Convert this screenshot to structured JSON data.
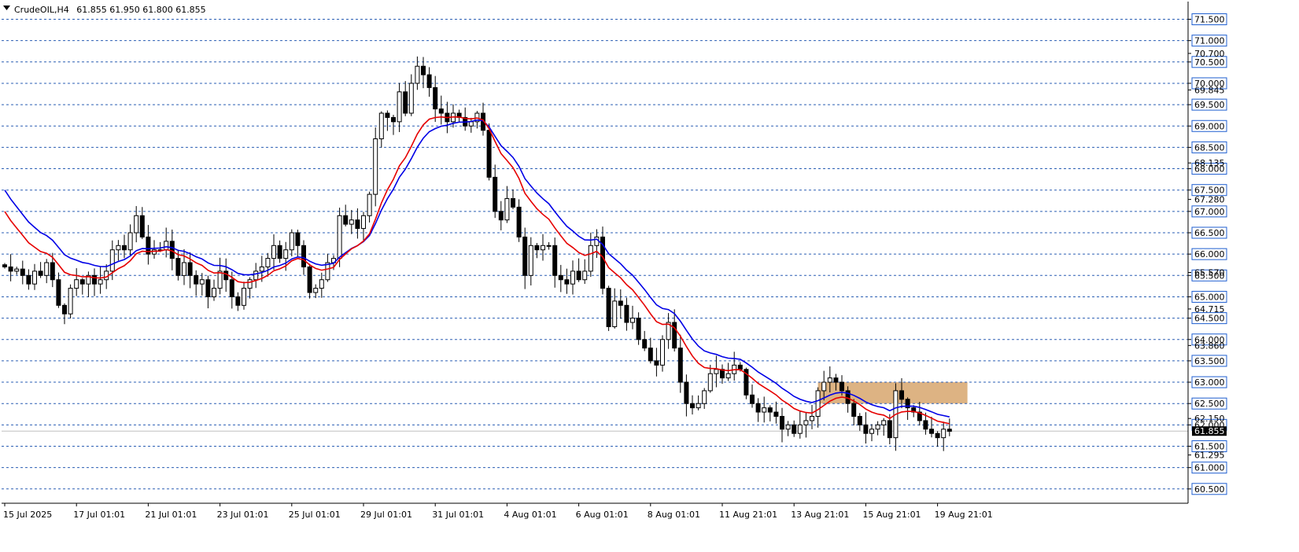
{
  "header": {
    "symbol": "CrudeOIL,H4",
    "ohlc": "61.855 61.950 61.800 61.855"
  },
  "colors": {
    "grid": "#2b5fb4",
    "ma_fast": "#e60000",
    "ma_slow": "#0000e6",
    "zone": "#ddb383",
    "tag_fill": "#1f5fd0",
    "current_tag": "#000000"
  },
  "chart_data": {
    "type": "candlestick",
    "timeframe": "H4",
    "ylim": [
      60.3,
      71.75
    ],
    "y_ticks_major": [
      71.5,
      71.0,
      70.5,
      70.0,
      69.5,
      69.0,
      68.5,
      68.0,
      67.5,
      67.0,
      66.5,
      66.0,
      65.5,
      65.0,
      64.5,
      64.0,
      63.5,
      63.0,
      62.5,
      62.0,
      61.5,
      61.0,
      60.5
    ],
    "y_ticks_labels": [
      "71.500",
      "71.000",
      "70.500",
      "70.000",
      "69.500",
      "69.000",
      "68.500",
      "68.000",
      "67.500",
      "67.000",
      "66.500",
      "66.000",
      "65.500",
      "65.000",
      "64.500",
      "64.000",
      "63.500",
      "63.000",
      "62.500",
      "62.000",
      "61.500",
      "61.000",
      "60.500"
    ],
    "y_ticks_minor": [
      {
        "value": 70.7,
        "label": "70.700"
      },
      {
        "value": 69.845,
        "label": "69.845"
      },
      {
        "value": 68.135,
        "label": "68.135"
      },
      {
        "value": 67.28,
        "label": "67.280"
      },
      {
        "value": 65.57,
        "label": "65.570"
      },
      {
        "value": 64.715,
        "label": "64.715"
      },
      {
        "value": 63.86,
        "label": "63.860"
      },
      {
        "value": 62.15,
        "label": "62.150"
      },
      {
        "value": 61.295,
        "label": "61.295"
      }
    ],
    "current_price": 61.855,
    "current_price_label": "61.855",
    "x_ticks": [
      "15 Jul 2025",
      "17 Jul 01:01",
      "21 Jul 01:01",
      "23 Jul 01:01",
      "25 Jul 01:01",
      "29 Jul 01:01",
      "31 Jul 01:01",
      "4 Aug 01:01",
      "6 Aug 01:01",
      "8 Aug 01:01",
      "11 Aug 21:01",
      "13 Aug 21:01",
      "15 Aug 21:01",
      "19 Aug 21:01"
    ],
    "x_tick_index": [
      0,
      12,
      24,
      36,
      48,
      60,
      72,
      84,
      96,
      108,
      120,
      132,
      144,
      156
    ],
    "zone": {
      "from_index": 136,
      "to_index": 161,
      "y_low": 62.5,
      "y_high": 63.0
    },
    "closes": [
      65.7,
      65.6,
      65.65,
      65.5,
      65.3,
      65.6,
      65.5,
      65.8,
      65.4,
      64.8,
      64.6,
      65.2,
      65.4,
      65.3,
      65.5,
      65.3,
      65.4,
      65.6,
      66.1,
      66.2,
      66.1,
      66.5,
      66.9,
      66.4,
      66.0,
      66.1,
      66.1,
      66.3,
      65.9,
      65.5,
      65.8,
      65.5,
      65.3,
      65.4,
      65.0,
      65.2,
      65.6,
      65.4,
      65.0,
      64.8,
      65.2,
      65.4,
      65.6,
      65.7,
      65.9,
      66.2,
      65.9,
      66.1,
      66.5,
      66.2,
      65.7,
      65.1,
      65.2,
      65.4,
      65.8,
      65.9,
      66.9,
      66.7,
      66.8,
      66.6,
      66.9,
      67.4,
      68.7,
      69.3,
      69.2,
      69.1,
      69.8,
      69.3,
      70.0,
      70.4,
      70.2,
      69.9,
      69.4,
      69.3,
      69.1,
      69.3,
      69.2,
      69.0,
      69.1,
      69.3,
      68.9,
      67.8,
      67.0,
      66.8,
      67.3,
      67.1,
      66.4,
      65.5,
      66.2,
      66.1,
      66.2,
      66.2,
      65.5,
      65.4,
      65.3,
      65.6,
      65.4,
      65.6,
      66.2,
      66.4,
      65.2,
      64.3,
      64.9,
      64.8,
      64.4,
      64.5,
      64.0,
      63.8,
      63.5,
      63.4,
      64.0,
      64.4,
      63.8,
      63.0,
      62.5,
      62.4,
      62.5,
      62.8,
      63.2,
      63.3,
      63.1,
      63.2,
      63.4,
      63.3,
      62.7,
      62.5,
      62.3,
      62.4,
      62.3,
      62.2,
      61.9,
      62.0,
      61.8,
      62.0,
      62.1,
      62.2,
      62.8,
      63.0,
      63.1,
      63.0,
      62.8,
      62.5,
      62.2,
      62.0,
      61.8,
      61.9,
      62.0,
      62.1,
      61.7,
      62.8,
      62.6,
      62.4,
      62.3,
      62.1,
      61.9,
      61.8,
      61.7,
      61.9,
      61.85
    ],
    "ma_fast_label": "",
    "ma_slow_label": ""
  }
}
